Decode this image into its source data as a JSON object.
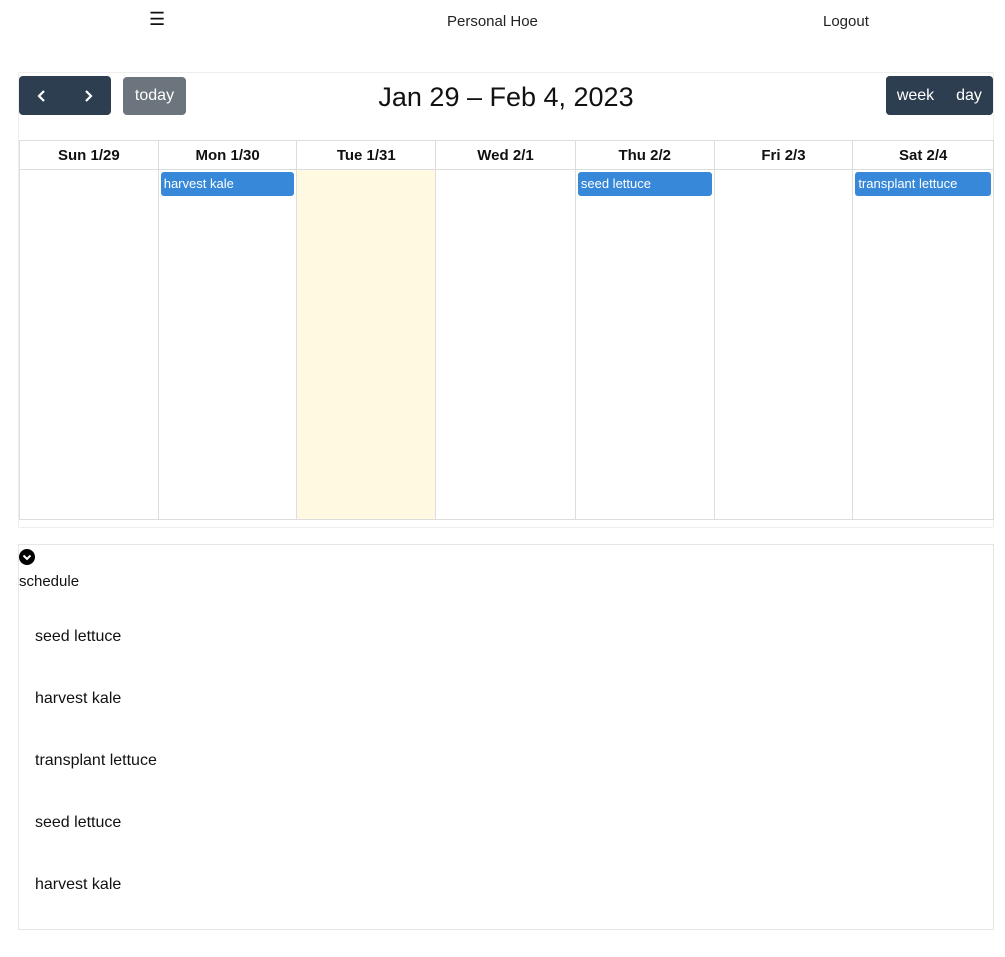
{
  "header": {
    "menu_glyph": "☰",
    "app_title": "Personal Hoe",
    "logout_label": "Logout"
  },
  "toolbar": {
    "prev_icon": "chevron-left-icon",
    "next_icon": "chevron-right-icon",
    "today_label": "today",
    "title": "Jan 29 – Feb 4, 2023",
    "week_label": "week",
    "day_label": "day"
  },
  "calendar": {
    "days": [
      {
        "label": "Sun 1/29",
        "today": false,
        "events": []
      },
      {
        "label": "Mon 1/30",
        "today": false,
        "events": [
          "harvest kale"
        ]
      },
      {
        "label": "Tue 1/31",
        "today": true,
        "events": []
      },
      {
        "label": "Wed 2/1",
        "today": false,
        "events": []
      },
      {
        "label": "Thu 2/2",
        "today": false,
        "events": [
          "seed lettuce"
        ]
      },
      {
        "label": "Fri 2/3",
        "today": false,
        "events": []
      },
      {
        "label": "Sat 2/4",
        "today": false,
        "events": [
          "transplant lettuce"
        ]
      }
    ]
  },
  "schedule": {
    "toggle_icon": "chevron-down-circle-icon",
    "label": "schedule",
    "items": [
      "seed lettuce",
      "harvest kale",
      "transplant lettuce",
      "seed lettuce",
      "harvest kale"
    ]
  },
  "colors": {
    "toolbar_dark": "#2c3e50",
    "today_button": "#6c757d",
    "event_blue": "#3788d8",
    "today_highlight": "#fef9e0"
  }
}
